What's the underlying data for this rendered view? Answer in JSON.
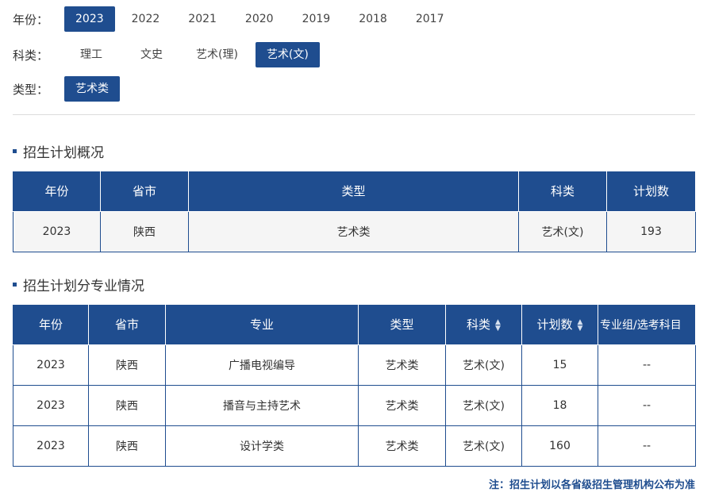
{
  "filters": {
    "year_label": "年份：",
    "years": [
      "2023",
      "2022",
      "2021",
      "2020",
      "2019",
      "2018",
      "2017"
    ],
    "subject_label": "科类：",
    "subjects": [
      "理工",
      "文史",
      "艺术(理)",
      "艺术(文)"
    ],
    "type_label": "类型：",
    "types": [
      "艺术类"
    ]
  },
  "overview": {
    "title": "招生计划概况",
    "headers": [
      "年份",
      "省市",
      "类型",
      "科类",
      "计划数"
    ],
    "rows": [
      [
        "2023",
        "陕西",
        "艺术类",
        "艺术(文)",
        "193"
      ]
    ]
  },
  "majors": {
    "title": "招生计划分专业情况",
    "headers": [
      "年份",
      "省市",
      "专业",
      "类型",
      "科类",
      "计划数",
      "专业组/选考科目"
    ],
    "rows": [
      [
        "2023",
        "陕西",
        "广播电视编导",
        "艺术类",
        "艺术(文)",
        "15",
        "--"
      ],
      [
        "2023",
        "陕西",
        "播音与主持艺术",
        "艺术类",
        "艺术(文)",
        "18",
        "--"
      ],
      [
        "2023",
        "陕西",
        "设计学类",
        "艺术类",
        "艺术(文)",
        "160",
        "--"
      ]
    ]
  },
  "note": "注：招生计划以各省级招生管理机构公布为准",
  "colors": {
    "accent": "#1f4d8f"
  }
}
